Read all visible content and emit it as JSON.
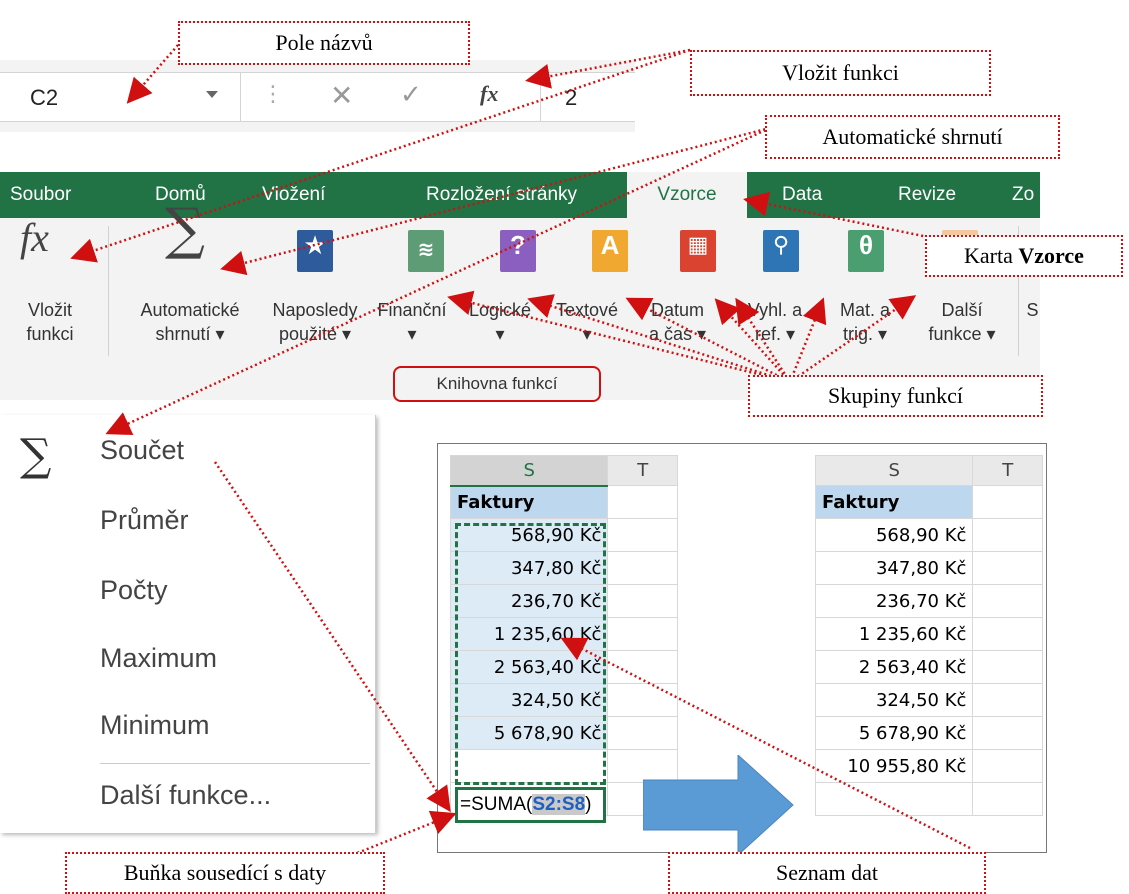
{
  "callouts": {
    "name_box": "Pole názvů",
    "insert_function": "Vložit funkci",
    "autosum": "Automatické shrnutí",
    "formulas_tab_prefix": "Karta ",
    "formulas_tab_bold": "Vzorce",
    "function_groups": "Skupiny funkcí",
    "adjacent_cell": "Buňka sousedící s daty",
    "data_list": "Seznam dat"
  },
  "formula_bar": {
    "name_box_value": "C2",
    "fx_label": "fx",
    "input_value": "2"
  },
  "ribbon": {
    "tabs": [
      "Soubor",
      "Domů",
      "Vložení",
      "Rozložení stránky",
      "Vzorce",
      "Data",
      "Revize",
      "Zo"
    ],
    "buttons": [
      {
        "line1": "Vložit",
        "line2": "funkci"
      },
      {
        "line1": "Automatické",
        "line2": "shrnutí ▾"
      },
      {
        "line1": "Naposledy",
        "line2": "použité ▾"
      },
      {
        "line1": "Finanční",
        "line2": "▾"
      },
      {
        "line1": "Logické",
        "line2": "▾"
      },
      {
        "line1": "Textové",
        "line2": "▾"
      },
      {
        "line1": "Datum",
        "line2": "a čas ▾"
      },
      {
        "line1": "Vyhl. a",
        "line2": "ref. ▾"
      },
      {
        "line1": "Mat. a",
        "line2": "trig. ▾"
      },
      {
        "line1": "Další",
        "line2": "funkce ▾"
      },
      {
        "line1": "S",
        "line2": ""
      }
    ],
    "group_label": "Knihovna funkcí"
  },
  "menu": {
    "items": [
      "Součet",
      "Průměr",
      "Počty",
      "Maximum",
      "Minimum",
      "Další funkce..."
    ]
  },
  "sheet_left": {
    "col_headers": [
      "S",
      "T"
    ],
    "header": "Faktury",
    "values": [
      "568,90 Kč",
      "347,80 Kč",
      "236,70 Kč",
      "1 235,60 Kč",
      "2 563,40 Kč",
      "324,50 Kč",
      "5 678,90 Kč"
    ],
    "formula_prefix": "=SUMA(",
    "formula_ref": "S2:S8",
    "formula_suffix": ")"
  },
  "sheet_right": {
    "col_headers": [
      "S",
      "T"
    ],
    "header": "Faktury",
    "values": [
      "568,90 Kč",
      "347,80 Kč",
      "236,70 Kč",
      "1 235,60 Kč",
      "2 563,40 Kč",
      "324,50 Kč",
      "5 678,90 Kč"
    ],
    "total": "10 955,80 Kč"
  },
  "colors": {
    "excel_green": "#217346",
    "callout_red": "#d01010",
    "arrow_blue": "#5b9bd5"
  }
}
